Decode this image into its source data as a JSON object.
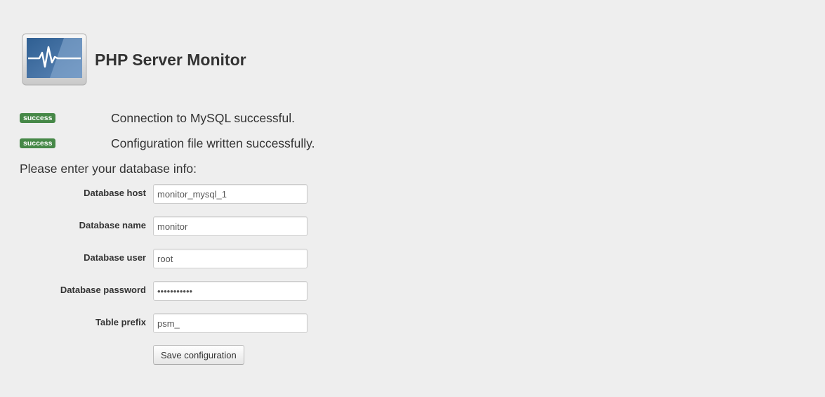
{
  "header": {
    "logo_icon": "server-monitor-heartbeat-icon",
    "title": "PHP Server Monitor"
  },
  "messages": [
    {
      "badge": "success",
      "text": "Connection to MySQL successful.",
      "color": "#468847"
    },
    {
      "badge": "success",
      "text": "Configuration file written successfully.",
      "color": "#468847"
    }
  ],
  "form": {
    "intro": "Please enter your database info:",
    "fields": [
      {
        "label": "Database host",
        "value": "monitor_mysql_1",
        "type": "text"
      },
      {
        "label": "Database name",
        "value": "monitor",
        "type": "text"
      },
      {
        "label": "Database user",
        "value": "root",
        "type": "text"
      },
      {
        "label": "Database password",
        "value": "monitorpass",
        "type": "password"
      },
      {
        "label": "Table prefix",
        "value": "psm_",
        "type": "text"
      }
    ],
    "save_label": "Save configuration"
  }
}
